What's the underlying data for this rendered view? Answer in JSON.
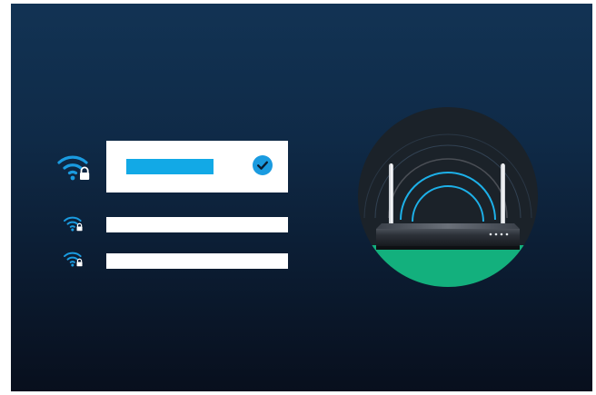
{
  "screen": {
    "background_top": "#123354",
    "background_bottom": "#080f1d",
    "selection_color": "#12a9e6",
    "accent_blue": "#1a9be0",
    "ground_color": "#13b07d"
  },
  "networks": [
    {
      "name": "",
      "selected": true,
      "secured": true,
      "icon": "wifi-lock-icon"
    },
    {
      "name": "",
      "selected": false,
      "secured": true,
      "icon": "wifi-lock-icon"
    },
    {
      "name": "",
      "selected": false,
      "secured": true,
      "icon": "wifi-lock-icon"
    }
  ],
  "selection_indicator": {
    "icon": "check-circle-icon"
  },
  "illustration": {
    "device": "router-icon",
    "signal": "signal-waves-icon",
    "indicator_lights": 4
  }
}
